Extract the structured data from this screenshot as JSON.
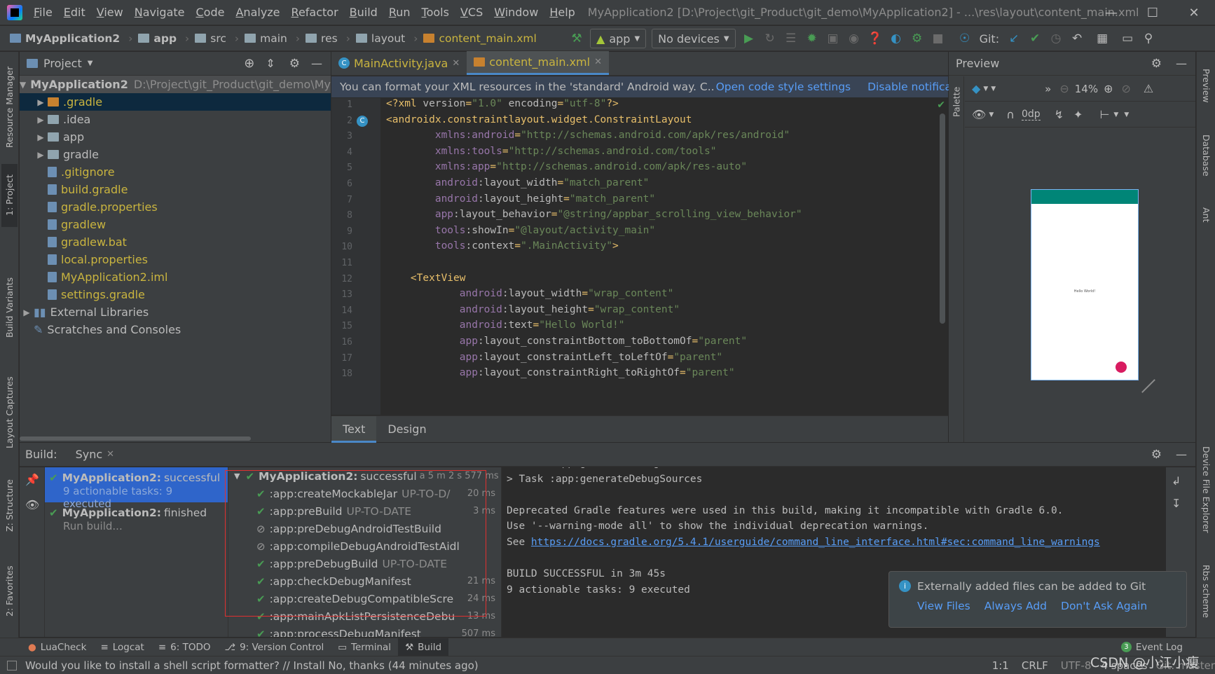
{
  "menubar": {
    "items": [
      "File",
      "Edit",
      "View",
      "Navigate",
      "Code",
      "Analyze",
      "Refactor",
      "Build",
      "Run",
      "Tools",
      "VCS",
      "Window",
      "Help"
    ],
    "title": "MyApplication2 [D:\\Project\\git_Product\\git_demo\\MyApplication2] - ...\\res\\layout\\content_main.xml"
  },
  "navbar": {
    "breadcrumbs": [
      "MyApplication2",
      "app",
      "src",
      "main",
      "res",
      "layout",
      "content_main.xml"
    ],
    "run_config": "app",
    "devices": "No devices",
    "git_label": "Git:"
  },
  "left_strip": {
    "tabs": [
      "Resource Manager",
      "1: Project",
      "Build Variants",
      "Layout Captures",
      "Z: Structure",
      "2: Favorites"
    ]
  },
  "right_strip": {
    "tabs": [
      "Preview",
      "Database",
      "Ant",
      "Device File Explorer",
      "Rbs scheme"
    ]
  },
  "project": {
    "header": "Project",
    "root_name": "MyApplication2",
    "root_path": "D:\\Project\\git_Product\\git_demo\\My",
    "items": [
      {
        "label": ".gradle",
        "color": "#c9b43f"
      },
      {
        "label": ".idea",
        "color": "#bbbbbb"
      },
      {
        "label": "app",
        "color": "#bbbbbb"
      },
      {
        "label": "gradle",
        "color": "#bbbbbb"
      },
      {
        "label": ".gitignore",
        "color": "#c9b43f"
      },
      {
        "label": "build.gradle",
        "color": "#c9b43f"
      },
      {
        "label": "gradle.properties",
        "color": "#c9b43f"
      },
      {
        "label": "gradlew",
        "color": "#c9b43f"
      },
      {
        "label": "gradlew.bat",
        "color": "#c9b43f"
      },
      {
        "label": "local.properties",
        "color": "#c9b43f"
      },
      {
        "label": "MyApplication2.iml",
        "color": "#c9b43f"
      },
      {
        "label": "settings.gradle",
        "color": "#c9b43f"
      }
    ],
    "external": "External Libraries",
    "scratches": "Scratches and Consoles"
  },
  "editor": {
    "tabs": [
      "MainActivity.java",
      "content_main.xml"
    ],
    "notification": "You can format your XML resources in the 'standard' Android way. C..",
    "notif_link1": "Open code style settings",
    "notif_link2": "Disable notification",
    "line_numbers": [
      "1",
      "2",
      "3",
      "4",
      "5",
      "6",
      "7",
      "8",
      "9",
      "10",
      "11",
      "12",
      "13",
      "14",
      "15",
      "16",
      "17",
      "18"
    ],
    "bottom_tabs": [
      "Text",
      "Design"
    ]
  },
  "preview": {
    "header": "Preview",
    "zoom": "14%",
    "margin": "0dp",
    "palette": "Palette",
    "hello": "Hello World!"
  },
  "build": {
    "label": "Build:",
    "sync_tab": "Sync",
    "left_items": [
      {
        "title": "MyApplication2:",
        "status": "successful",
        "sub": "9 actionable tasks: 9 executed"
      },
      {
        "title": "MyApplication2:",
        "status": "finished",
        "sub": "Run build..."
      }
    ],
    "tree_root": {
      "title": "MyApplication2:",
      "status": "successful",
      "time": "a 5 m 2 s 577 ms"
    },
    "tasks": [
      {
        "name": ":app:createMockableJar",
        "state": "UP-TO-D/",
        "time": "20 ms",
        "icon": "check"
      },
      {
        "name": ":app:preBuild",
        "state": "UP-TO-DATE",
        "time": "3 ms",
        "icon": "check"
      },
      {
        "name": ":app:preDebugAndroidTestBuild",
        "state": "",
        "time": "",
        "icon": "skip"
      },
      {
        "name": ":app:compileDebugAndroidTestAidl",
        "state": "",
        "time": "",
        "icon": "skip"
      },
      {
        "name": ":app:preDebugBuild",
        "state": "UP-TO-DATE",
        "time": "",
        "icon": "check"
      },
      {
        "name": ":app:checkDebugManifest",
        "state": "",
        "time": "21 ms",
        "icon": "check"
      },
      {
        "name": ":app:createDebugCompatibleScre",
        "state": "",
        "time": "24 ms",
        "icon": "check"
      },
      {
        "name": ":app:mainApkListPersistenceDebu",
        "state": "",
        "time": "13 ms",
        "icon": "check"
      },
      {
        "name": ":app:processDebugManifest",
        "state": "",
        "time": "507 ms",
        "icon": "check"
      }
    ],
    "console": [
      "> Task :app:generateDebugAndroidTestSources",
      "> Task :app:generateDebugSources",
      "",
      "Deprecated Gradle features were used in this build, making it incompatible with Gradle 6.0.",
      "Use '--warning-mode all' to show the individual deprecation warnings.",
      "See ",
      "",
      "BUILD SUCCESSFUL in 3m 45s",
      "9 actionable tasks: 9 executed"
    ],
    "console_link": "https://docs.gradle.org/5.4.1/userguide/command_line_interface.html#sec:command_line_warnings"
  },
  "balloon": {
    "message": "Externally added files can be added to Git",
    "actions": [
      "View Files",
      "Always Add",
      "Don't Ask Again"
    ]
  },
  "bottom_tabs": [
    "LuaCheck",
    "Logcat",
    "6: TODO",
    "9: Version Control",
    "Terminal",
    "Build"
  ],
  "event_log": "Event Log",
  "event_count": "3",
  "status": {
    "message": "Would you like to install a shell script formatter? // Install   No, thanks (44 minutes ago)",
    "position": "1:1",
    "line_sep": "CRLF",
    "encoding": "UTF-8",
    "indent": "4 spaces",
    "git": "Git: master",
    "watermark": "CSDN @小江小瘦"
  }
}
